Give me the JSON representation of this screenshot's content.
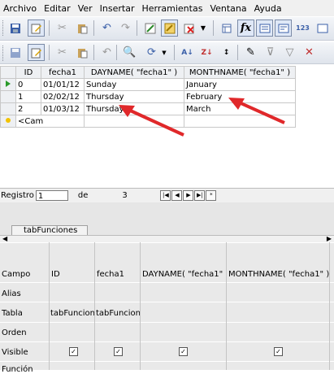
{
  "menu": [
    "Archivo",
    "Editar",
    "Ver",
    "Insertar",
    "Herramientas",
    "Ventana",
    "Ayuda"
  ],
  "toolbar1": {
    "icons": [
      "save-icon",
      "edit-icon",
      "cut-icon",
      "paste-icon",
      "undo-icon",
      "redo-icon",
      "design-icon",
      "sql-icon",
      "delete-icon",
      "run-icon",
      "functions-icon",
      "alias-icon",
      "table-names-icon",
      "distinct-icon",
      "limit-icon"
    ]
  },
  "toolbar2": {
    "icons": [
      "save-icon",
      "edit-icon",
      "cut-icon",
      "paste-icon",
      "undo-icon",
      "find-icon",
      "refresh-icon",
      "sort-asc-icon",
      "sort-desc-icon",
      "sort-icon",
      "autofilter-icon",
      "filter-icon",
      "remove-filter-icon"
    ]
  },
  "grid": {
    "headers": [
      "ID",
      "fecha1",
      "DAYNAME( \"fecha1\" )",
      "MONTHNAME( \"fecha1\" )"
    ],
    "rows": [
      [
        "0",
        "01/01/12",
        "Sunday",
        "January"
      ],
      [
        "1",
        "02/02/12",
        "Thursday",
        "February"
      ],
      [
        "2",
        "01/03/12",
        "Thursday",
        "March"
      ]
    ],
    "new_row": "<Cam"
  },
  "nav": {
    "label": "Registro",
    "record": "1",
    "of_label": "de",
    "total": "3"
  },
  "query_tab": "tabFunciones",
  "design": {
    "row_labels": [
      "Campo",
      "Alias",
      "Tabla",
      "Orden",
      "Visible",
      "Función"
    ],
    "columns": [
      {
        "field": "ID",
        "table": "tabFuncion"
      },
      {
        "field": "fecha1",
        "table": "tabFuncion"
      },
      {
        "field": "DAYNAME( \"fecha1\" )",
        "table": ""
      },
      {
        "field": "MONTHNAME( \"fecha1\" )",
        "table": ""
      }
    ]
  },
  "colors": {
    "arrow": "#e0282a",
    "toolbar_top": "#f4f6f9",
    "grid_header": "#eef0f3"
  }
}
